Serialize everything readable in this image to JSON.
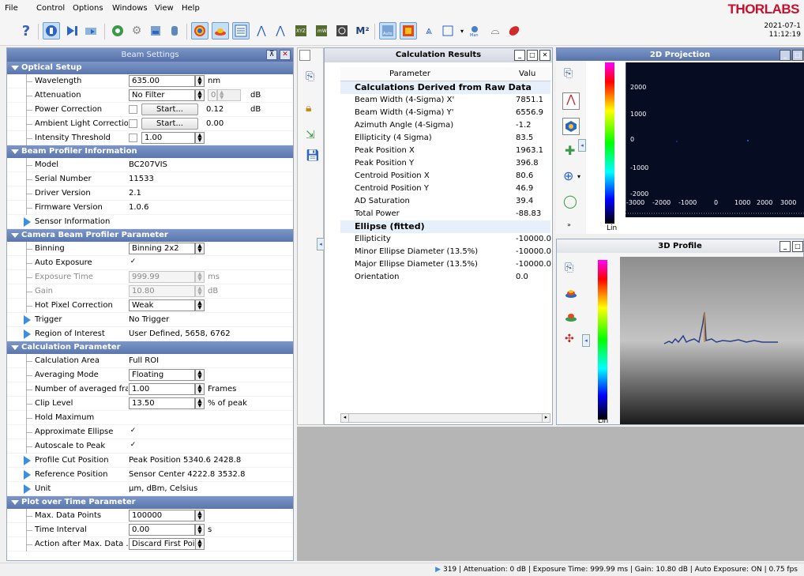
{
  "menu": [
    "File",
    "Control",
    "Options",
    "Windows",
    "View",
    "Help"
  ],
  "logo": "THORLABS",
  "datetime": {
    "date": "2021-07-1",
    "time": "11:12:19"
  },
  "beam_settings": {
    "title": "Beam Settings",
    "sections": [
      {
        "title": "Optical Setup",
        "rows": [
          {
            "label": "Wavelength",
            "value": "635.00",
            "unit": "nm"
          },
          {
            "label": "Attenuation",
            "value": "No Filter",
            "value2": "0",
            "unit": "dB"
          },
          {
            "label": "Power Correction",
            "button": "Start...",
            "value": "0.12",
            "unit": "dB"
          },
          {
            "label": "Ambient Light Correction",
            "button": "Start...",
            "value": "0.00"
          },
          {
            "label": "Intensity Threshold",
            "value": "1.00"
          }
        ]
      },
      {
        "title": "Beam Profiler Information",
        "rows": [
          {
            "label": "Model",
            "value": "BC207VIS"
          },
          {
            "label": "Serial Number",
            "value": "11533"
          },
          {
            "label": "Driver Version",
            "value": "2.1"
          },
          {
            "label": "Firmware Version",
            "value": "1.0.6"
          },
          {
            "label": "Sensor Information",
            "value": ""
          }
        ]
      },
      {
        "title": "Camera Beam Profiler Parameter",
        "rows": [
          {
            "label": "Binning",
            "value": "Binning 2x2"
          },
          {
            "label": "Auto Exposure",
            "value": "✓"
          },
          {
            "label": "Exposure Time",
            "value": "999.99",
            "unit": "ms"
          },
          {
            "label": "Gain",
            "value": "10.80",
            "unit": "dB"
          },
          {
            "label": "Hot Pixel Correction",
            "value": "Weak"
          },
          {
            "label": "Trigger",
            "value": "No Trigger"
          },
          {
            "label": "Region of Interest",
            "value": "User Defined, 5658, 6762"
          }
        ]
      },
      {
        "title": "Calculation Parameter",
        "rows": [
          {
            "label": "Calculation Area",
            "value": "Full ROI"
          },
          {
            "label": "Averaging Mode",
            "value": "Floating"
          },
          {
            "label": "Number of averaged fra...",
            "value": "1.00",
            "unit": "Frames"
          },
          {
            "label": "Clip Level",
            "value": "13.50",
            "unit": "% of peak"
          },
          {
            "label": "Hold Maximum",
            "value": ""
          },
          {
            "label": "Approximate Ellipse",
            "value": "✓"
          },
          {
            "label": "Autoscale to Peak",
            "value": "✓"
          },
          {
            "label": "Profile Cut Position",
            "value": "Peak Position 5340.6 2428.8"
          },
          {
            "label": "Reference Position",
            "value": "Sensor Center 4222.8 3532.8"
          },
          {
            "label": "Unit",
            "value": "µm, dBm, Celsius"
          }
        ]
      },
      {
        "title": "Plot over Time Parameter",
        "rows": [
          {
            "label": "Max. Data Points",
            "value": "100000"
          },
          {
            "label": "Time Interval",
            "value": "0.00",
            "unit": "s"
          },
          {
            "label": "Action after Max. Data ...",
            "value": "Discard First Point"
          }
        ]
      }
    ]
  },
  "calc": {
    "title": "Calculation Results",
    "headers": [
      "Parameter",
      "Valu"
    ],
    "group1": "Calculations Derived from Raw Data",
    "rows1": [
      [
        "Beam Width (4-Sigma) X'",
        "7851.1"
      ],
      [
        "Beam Width (4-Sigma) Y'",
        "6556.9"
      ],
      [
        "Azimuth Angle (4-Sigma)",
        "-1.2"
      ],
      [
        "Ellipticity (4 Sigma)",
        "83.5"
      ],
      [
        "Peak Position X",
        "1963.1"
      ],
      [
        "Peak Position Y",
        "396.8"
      ],
      [
        "Centroid Position X",
        "80.6"
      ],
      [
        "Centroid Position Y",
        "46.9"
      ],
      [
        "AD Saturation",
        "39.4"
      ],
      [
        "Total Power",
        "-88.83"
      ]
    ],
    "group2": "Ellipse (fitted)",
    "rows2": [
      [
        "Ellipticity",
        "-10000.0"
      ],
      [
        "Minor Ellipse Diameter (13.5%)",
        "-10000.0"
      ],
      [
        "Major Ellipse Diameter (13.5%)",
        "-10000.0"
      ],
      [
        "Orientation",
        "0.0"
      ]
    ]
  },
  "proj2d": {
    "title": "2D Projection",
    "yticks": [
      "2000",
      "1000",
      "0",
      "-1000",
      "-2000"
    ],
    "xticks": [
      "-3000",
      "-2000",
      "-1000",
      "0",
      "1000",
      "2000",
      "3000"
    ],
    "scale": "Lin"
  },
  "profile3d": {
    "title": "3D Profile",
    "scale": "Lin"
  },
  "status": "319 | Attenuation: 0 dB | Exposure Time: 999.99 ms | Gain: 10.80 dB | Auto Exposure: ON |     0.75 fps"
}
